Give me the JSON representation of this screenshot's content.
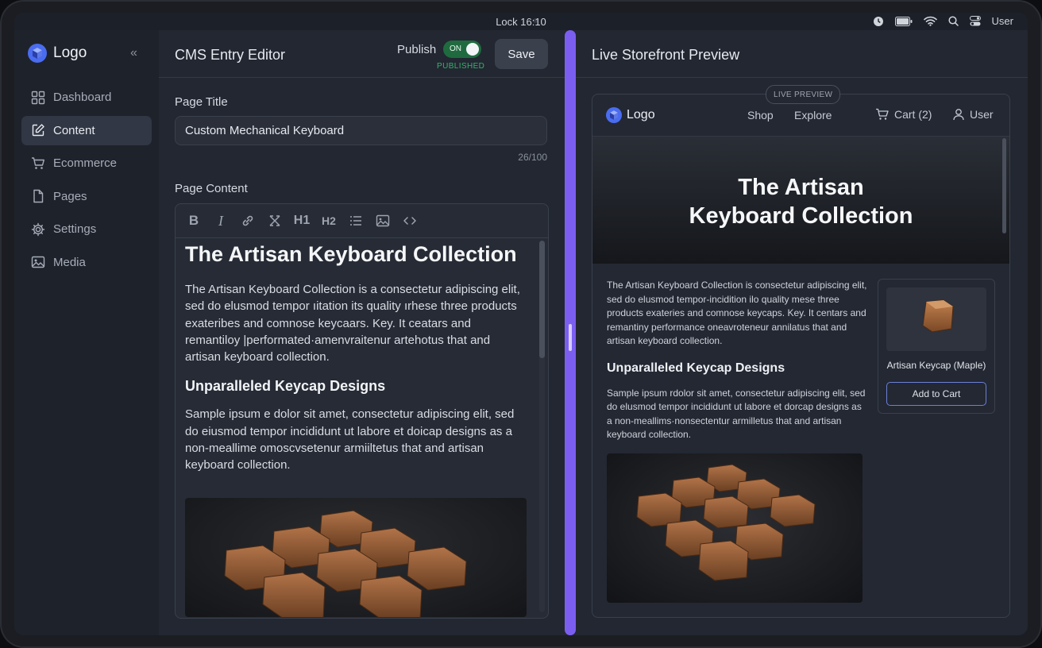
{
  "status_bar": {
    "time": "Lock 16:10",
    "user": "User"
  },
  "sidebar": {
    "logo": "Logo",
    "items": [
      {
        "label": "Dashboard",
        "icon": "grid-icon",
        "active": false
      },
      {
        "label": "Content",
        "icon": "edit-icon",
        "active": true
      },
      {
        "label": "Ecommerce",
        "icon": "cart-icon",
        "active": false
      },
      {
        "label": "Pages",
        "icon": "file-icon",
        "active": false
      },
      {
        "label": "Settings",
        "icon": "gear-icon",
        "active": false
      },
      {
        "label": "Media",
        "icon": "image-icon",
        "active": false
      }
    ]
  },
  "editor": {
    "title": "CMS Entry Editor",
    "publish_label": "Publish",
    "toggle_state": "ON",
    "publish_status": "PUBLISHED",
    "save_label": "Save",
    "page_title_label": "Page Title",
    "page_title_value": "Custom Mechanical Keyboard",
    "title_counter": "26/100",
    "page_content_label": "Page Content",
    "toolbar": {
      "bold": "B",
      "italic": "I",
      "h1": "H1",
      "h2": "H2"
    },
    "content": {
      "heading": "The Artisan Keyboard Collection",
      "paragraph1": "The Artisan Keyboard Collection is a consectetur adipiscing elit, sed do elusmod tempor ıitation its quality ırhese three products exateribes and comnose keycaars. Key. It ceatars and remantiloy |performated·amenvraitenur artehotus that and artisan keyboard collection.",
      "subheading": "Unparalleled Keycap Designs",
      "paragraph2": "Sample ipsum e dolor sit amet, consectetur adipiscing elit, sed do eiusmod tempor incididunt ut labore et doicap designs as a non-meallime omoscvsetenur armiiltetus that and artisan keyboard collection."
    }
  },
  "preview": {
    "title": "Live Storefront Preview",
    "badge": "LIVE PREVIEW",
    "store": {
      "logo": "Logo",
      "nav": [
        "Shop",
        "Explore"
      ],
      "cart": "Cart (2)",
      "user": "User"
    },
    "hero_title": "The Artisan Keyboard Collection",
    "paragraph1": "The Artisan Keyboard Collection is consectetur adipiscing elit, sed do elusmod tempor-incidition ilo quality mese three products exateries and comnose keycaps. Key. It centars and remantiny performance oneavroteneur annilatus that and artisan keyboard collection.",
    "subheading": "Unparalleled Keycap Designs",
    "paragraph2": "Sample ipsum rdolor sit amet, consectetur adipiscing elit, sed do elusmod tempor incididunt ut labore et dorcap designs as a non-meallims·nonsectentur armilletus that and artisan keyboard collection.",
    "product": {
      "name": "Artisan Keycap (Maple)",
      "button": "Add to Cart"
    }
  },
  "colors": {
    "accent": "#7b5ef0",
    "toggle_on": "#1f6b3f",
    "published": "#37b36a",
    "brand_logo": "#4a6cf0"
  }
}
